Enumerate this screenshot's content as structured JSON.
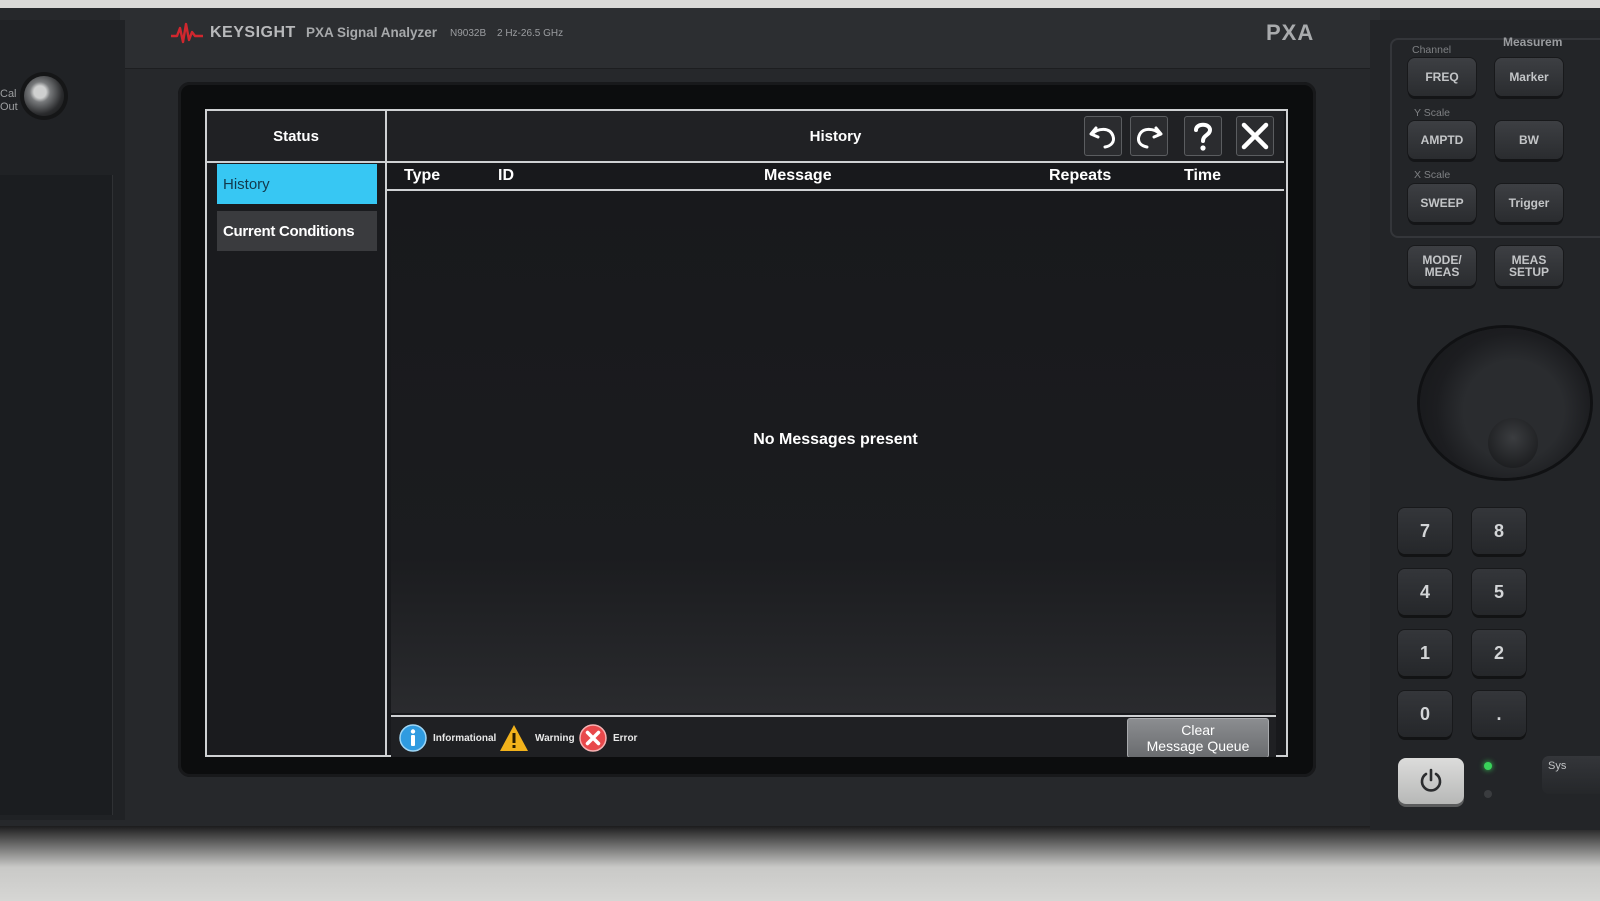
{
  "instrument": {
    "brand": "KEYSIGHT",
    "model_name": "PXA Signal Analyzer",
    "model_number": "N9032B",
    "frequency_range": "2 Hz-26.5 GHz",
    "badge": "PXA",
    "cal_out_label_1": "Cal",
    "cal_out_label_2": "Out"
  },
  "status_panel": {
    "title": "Status",
    "items": [
      {
        "label": "History",
        "selected": true
      },
      {
        "label": "Current Conditions",
        "selected": false
      }
    ]
  },
  "history_panel": {
    "title": "History",
    "columns": [
      "Type",
      "ID",
      "Message",
      "Repeats",
      "Time"
    ],
    "rows": [],
    "empty_message": "No Messages present",
    "toolbar": {
      "undo_icon": "undo-icon",
      "redo_icon": "redo-icon",
      "help_icon": "help-icon",
      "close_icon": "close-icon"
    },
    "legend": [
      {
        "label": "Informational",
        "icon": "info-icon",
        "color": "#2f9be0"
      },
      {
        "label": "Warning",
        "icon": "warning-icon",
        "color": "#f2b21b"
      },
      {
        "label": "Error",
        "icon": "error-icon",
        "color": "#e8484b"
      }
    ],
    "clear_button_line1": "Clear",
    "clear_button_line2": "Message Queue"
  },
  "hardkeys": {
    "group_channel": "Channel",
    "group_measure": "Measurem",
    "group_yscale": "Y Scale",
    "group_xscale": "X Scale",
    "freq": "FREQ",
    "marker": "Marker",
    "amptd": "AMPTD",
    "bw": "BW",
    "sweep": "SWEEP",
    "trigger": "Trigger",
    "mode_meas_1": "MODE/",
    "mode_meas_2": "MEAS",
    "meas_setup_1": "MEAS",
    "meas_setup_2": "SETUP",
    "sys": "Sys"
  },
  "keypad": [
    "7",
    "8",
    "4",
    "5",
    "1",
    "2",
    "0",
    "."
  ],
  "colors": {
    "selected_tab": "#37c7f3",
    "panel_border": "#cfd1d3",
    "screen_bg": "#18191c",
    "power_led": "#39d35a"
  }
}
